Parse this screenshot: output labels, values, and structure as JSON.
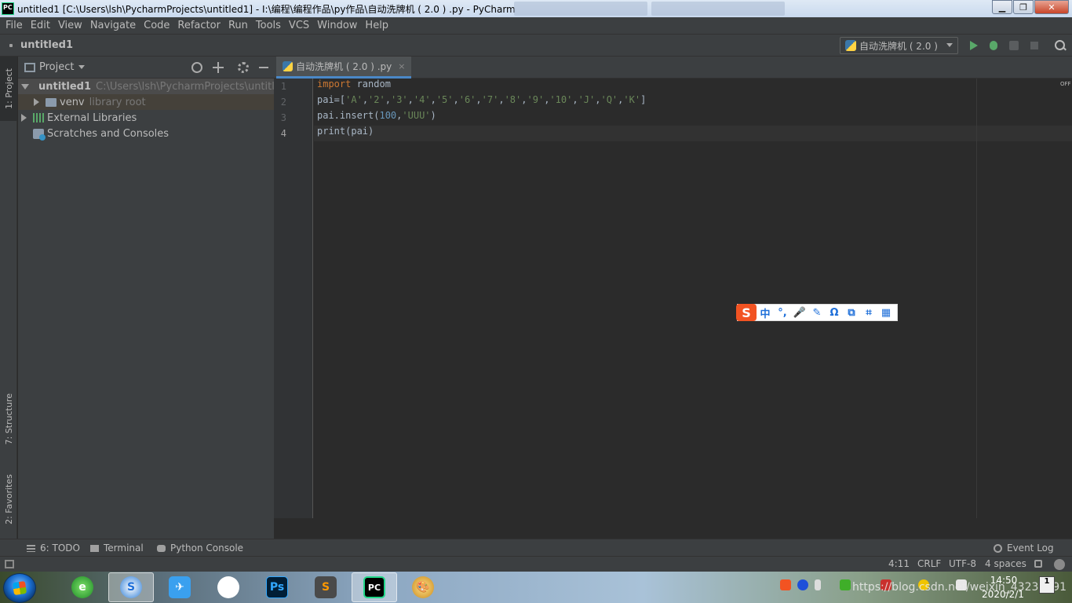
{
  "window": {
    "title": "untitled1 [C:\\Users\\lsh\\PycharmProjects\\untitled1] - I:\\编程\\编程作品\\py作品\\自动洗牌机 ( 2.0 ) .py - PyCharm",
    "app_icon_text": "PC",
    "minimize": "▁",
    "maximize": "❐",
    "close": "✕"
  },
  "menu": [
    "File",
    "Edit",
    "View",
    "Navigate",
    "Code",
    "Refactor",
    "Run",
    "Tools",
    "VCS",
    "Window",
    "Help"
  ],
  "navbar": {
    "project_name": "untitled1",
    "run_config": "自动洗牌机 ( 2.0 )"
  },
  "left_stripe": {
    "project": "1: Project",
    "structure": "7: Structure",
    "favorites": "2: Favorites"
  },
  "project_panel": {
    "title": "Project",
    "tree": {
      "root_name": "untitled1",
      "root_path": "C:\\Users\\lsh\\PycharmProjects\\untitled1",
      "venv_name": "venv",
      "venv_note": "library root",
      "external": "External Libraries",
      "scratches": "Scratches and Consoles"
    }
  },
  "editor": {
    "tab_label": "自动洗牌机 ( 2.0 ) .py",
    "tab_close": "×",
    "line_numbers": [
      "1",
      "2",
      "3",
      "4"
    ],
    "off_label": "OFF",
    "code": {
      "l1_kw": "import",
      "l1_rest": " random",
      "l2_a": "pai=[",
      "l2_items": [
        "'A'",
        "'2'",
        "'3'",
        "'4'",
        "'5'",
        "'6'",
        "'7'",
        "'8'",
        "'9'",
        "'10'",
        "'J'",
        "'Q'",
        "'K'"
      ],
      "l2_end": "]",
      "l3_a": "pai.insert(",
      "l3_num": "100",
      "l3_comma": ",",
      "l3_str": "'UUU'",
      "l3_end": ")",
      "l4": "print(pai)"
    }
  },
  "ime": {
    "logo": "S",
    "icons": [
      "中",
      "°,",
      "🎤",
      "✎",
      "Ω",
      "⧉",
      "⌗",
      "▦"
    ]
  },
  "bottom_tools": {
    "todo": "6: TODO",
    "terminal": "Terminal",
    "python_console": "Python Console",
    "event_log": "Event Log"
  },
  "status": {
    "position": "4:11",
    "line_sep": "CRLF",
    "encoding": "UTF-8",
    "indent": "4 spaces"
  },
  "taskbar": {
    "apps": [
      "e",
      "S",
      "✈",
      "⟳",
      "Ps",
      "S",
      "PC",
      "🎨"
    ],
    "time": "14:50",
    "date": "2020/2/1",
    "watermark": "https://blog.csdn.net/weixin_43231891",
    "notif": "1"
  }
}
